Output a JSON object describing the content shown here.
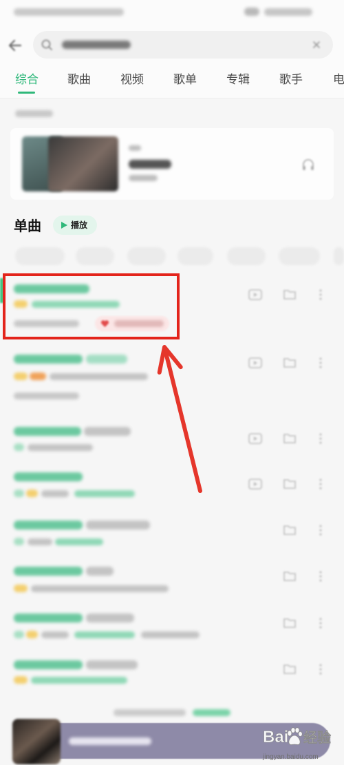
{
  "tabs": [
    {
      "label": "综合",
      "active": true
    },
    {
      "label": "歌曲",
      "active": false
    },
    {
      "label": "视频",
      "active": false
    },
    {
      "label": "歌单",
      "active": false
    },
    {
      "label": "专辑",
      "active": false
    },
    {
      "label": "歌手",
      "active": false
    },
    {
      "label": "电",
      "active": false
    }
  ],
  "songs_section": {
    "title": "单曲",
    "play_button": "播放"
  },
  "watermark": {
    "brand": "Bai",
    "product": "经验",
    "url": "jingyan.baidu.com"
  },
  "colors": {
    "accent": "#2fb87a",
    "tab_text": "#4a4a4a",
    "highlight_box": "#e3241b",
    "annotation_arrow": "#e5362b",
    "player_bar": "#8e8aa8",
    "play_pill": "#e3f5ec"
  },
  "icons": {
    "back": "back-arrow-icon",
    "search": "search-icon",
    "clear": "close-icon",
    "recommend_card": "headphone-icon",
    "play": "play-icon",
    "song_mv": "mv-icon",
    "song_add": "add-to-playlist-icon",
    "song_more": "more-icon",
    "chip": "heart-icon",
    "watermark": "baidu-paw-icon"
  }
}
